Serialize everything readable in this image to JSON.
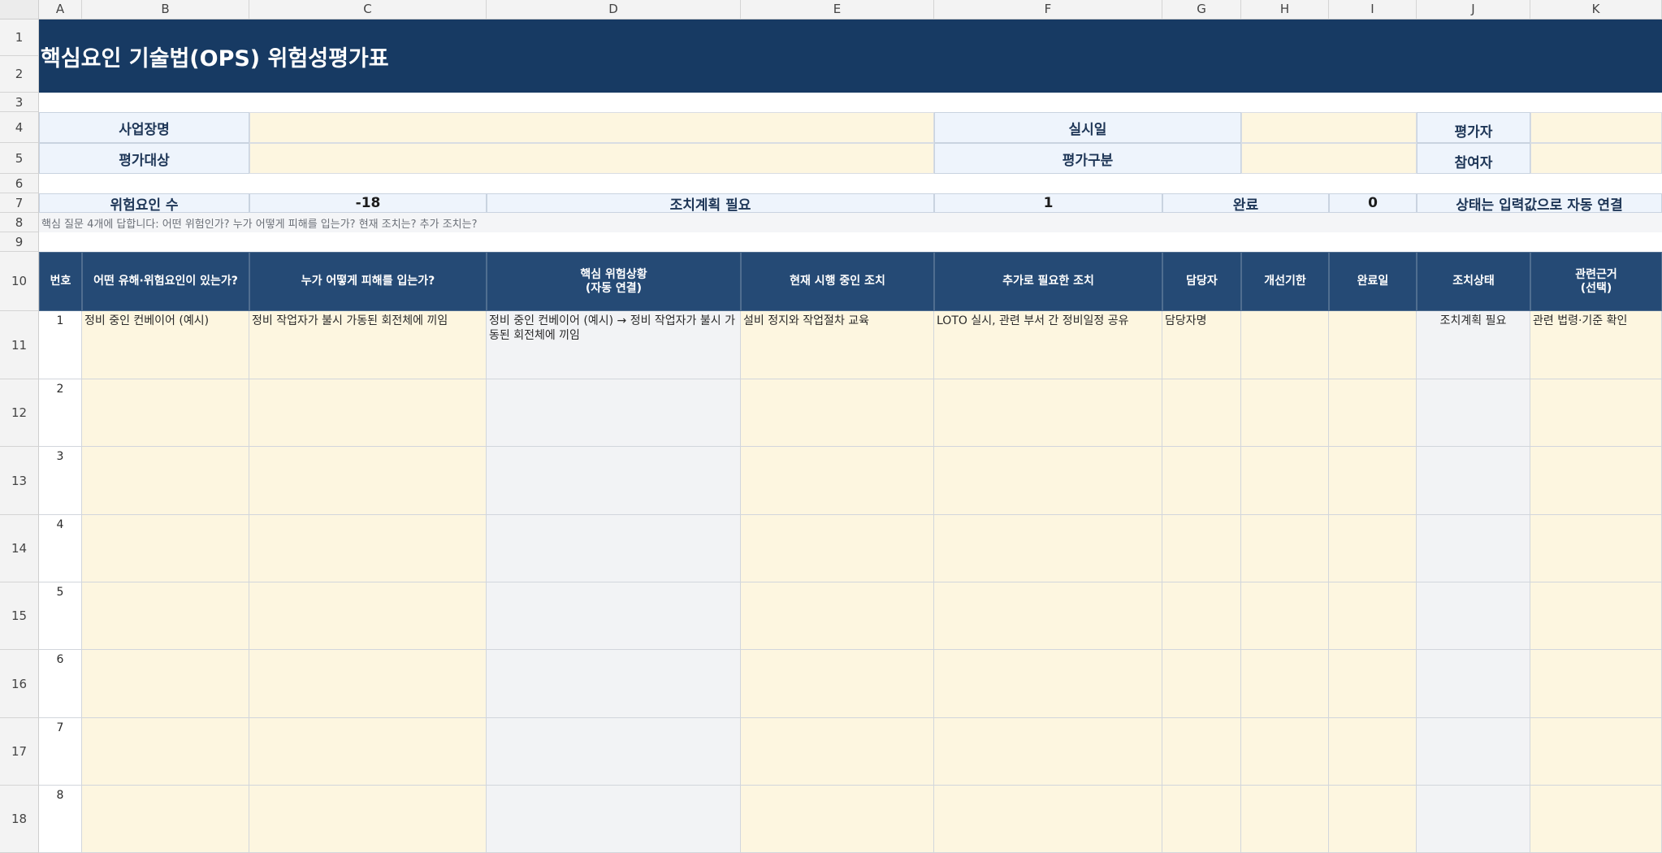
{
  "columns": [
    "A",
    "B",
    "C",
    "D",
    "E",
    "F",
    "G",
    "H",
    "I",
    "J",
    "K"
  ],
  "rows": [
    "1",
    "2",
    "3",
    "4",
    "5",
    "6",
    "7",
    "8",
    "9",
    "10",
    "11",
    "12",
    "13",
    "14",
    "15",
    "16",
    "17",
    "18"
  ],
  "title": "핵심요인 기술법(OPS) 위험성평가표",
  "info": {
    "site_label": "사업장명",
    "site_value": "",
    "date_label": "실시일",
    "date_value": "",
    "assessor_label": "평가자",
    "assessor_value": "",
    "target_label": "평가대상",
    "target_value": "",
    "type_label": "평가구분",
    "type_value": "",
    "participant_label": "참여자",
    "participant_value": ""
  },
  "summary": {
    "risk_count_label": "위험요인 수",
    "risk_count_value": "-18",
    "action_needed_label": "조치계획 필요",
    "action_needed_value": "1",
    "done_label": "완료",
    "done_value": "0",
    "auto_note": "상태는 입력값으로 자동 연결"
  },
  "guide": "핵심 질문 4개에 답합니다: 어떤 위험인가? 누가 어떻게 피해를 입는가? 현재 조치는? 추가 조치는?",
  "table": {
    "headers": [
      "번호",
      "어떤 유해·위험요인이 있는가?",
      "누가 어떻게 피해를 입는가?",
      "핵심 위험상황\n(자동 연결)",
      "현재 시행 중인 조치",
      "추가로 필요한 조치",
      "담당자",
      "개선기한",
      "완료일",
      "조치상태",
      "관련근거\n(선택)"
    ],
    "rows": [
      {
        "no": "1",
        "hazard": "정비 중인 컨베이어 (예시)",
        "harm": "정비 작업자가 불시 가동된 회전체에 끼임",
        "situation": "정비 중인 컨베이어 (예시) → 정비 작업자가 불시 가동된 회전체에 끼임",
        "current": "설비 정지와 작업절차 교육",
        "additional": "LOTO 실시, 관련 부서 간 정비일정 공유",
        "owner": "담당자명",
        "deadline": "",
        "done_date": "",
        "status": "조치계획 필요",
        "basis": "관련 법령·기준 확인"
      },
      {
        "no": "2",
        "hazard": "",
        "harm": "",
        "situation": "",
        "current": "",
        "additional": "",
        "owner": "",
        "deadline": "",
        "done_date": "",
        "status": "",
        "basis": ""
      },
      {
        "no": "3",
        "hazard": "",
        "harm": "",
        "situation": "",
        "current": "",
        "additional": "",
        "owner": "",
        "deadline": "",
        "done_date": "",
        "status": "",
        "basis": ""
      },
      {
        "no": "4",
        "hazard": "",
        "harm": "",
        "situation": "",
        "current": "",
        "additional": "",
        "owner": "",
        "deadline": "",
        "done_date": "",
        "status": "",
        "basis": ""
      },
      {
        "no": "5",
        "hazard": "",
        "harm": "",
        "situation": "",
        "current": "",
        "additional": "",
        "owner": "",
        "deadline": "",
        "done_date": "",
        "status": "",
        "basis": ""
      },
      {
        "no": "6",
        "hazard": "",
        "harm": "",
        "situation": "",
        "current": "",
        "additional": "",
        "owner": "",
        "deadline": "",
        "done_date": "",
        "status": "",
        "basis": ""
      },
      {
        "no": "7",
        "hazard": "",
        "harm": "",
        "situation": "",
        "current": "",
        "additional": "",
        "owner": "",
        "deadline": "",
        "done_date": "",
        "status": "",
        "basis": ""
      },
      {
        "no": "8",
        "hazard": "",
        "harm": "",
        "situation": "",
        "current": "",
        "additional": "",
        "owner": "",
        "deadline": "",
        "done_date": "",
        "status": "",
        "basis": ""
      }
    ]
  }
}
